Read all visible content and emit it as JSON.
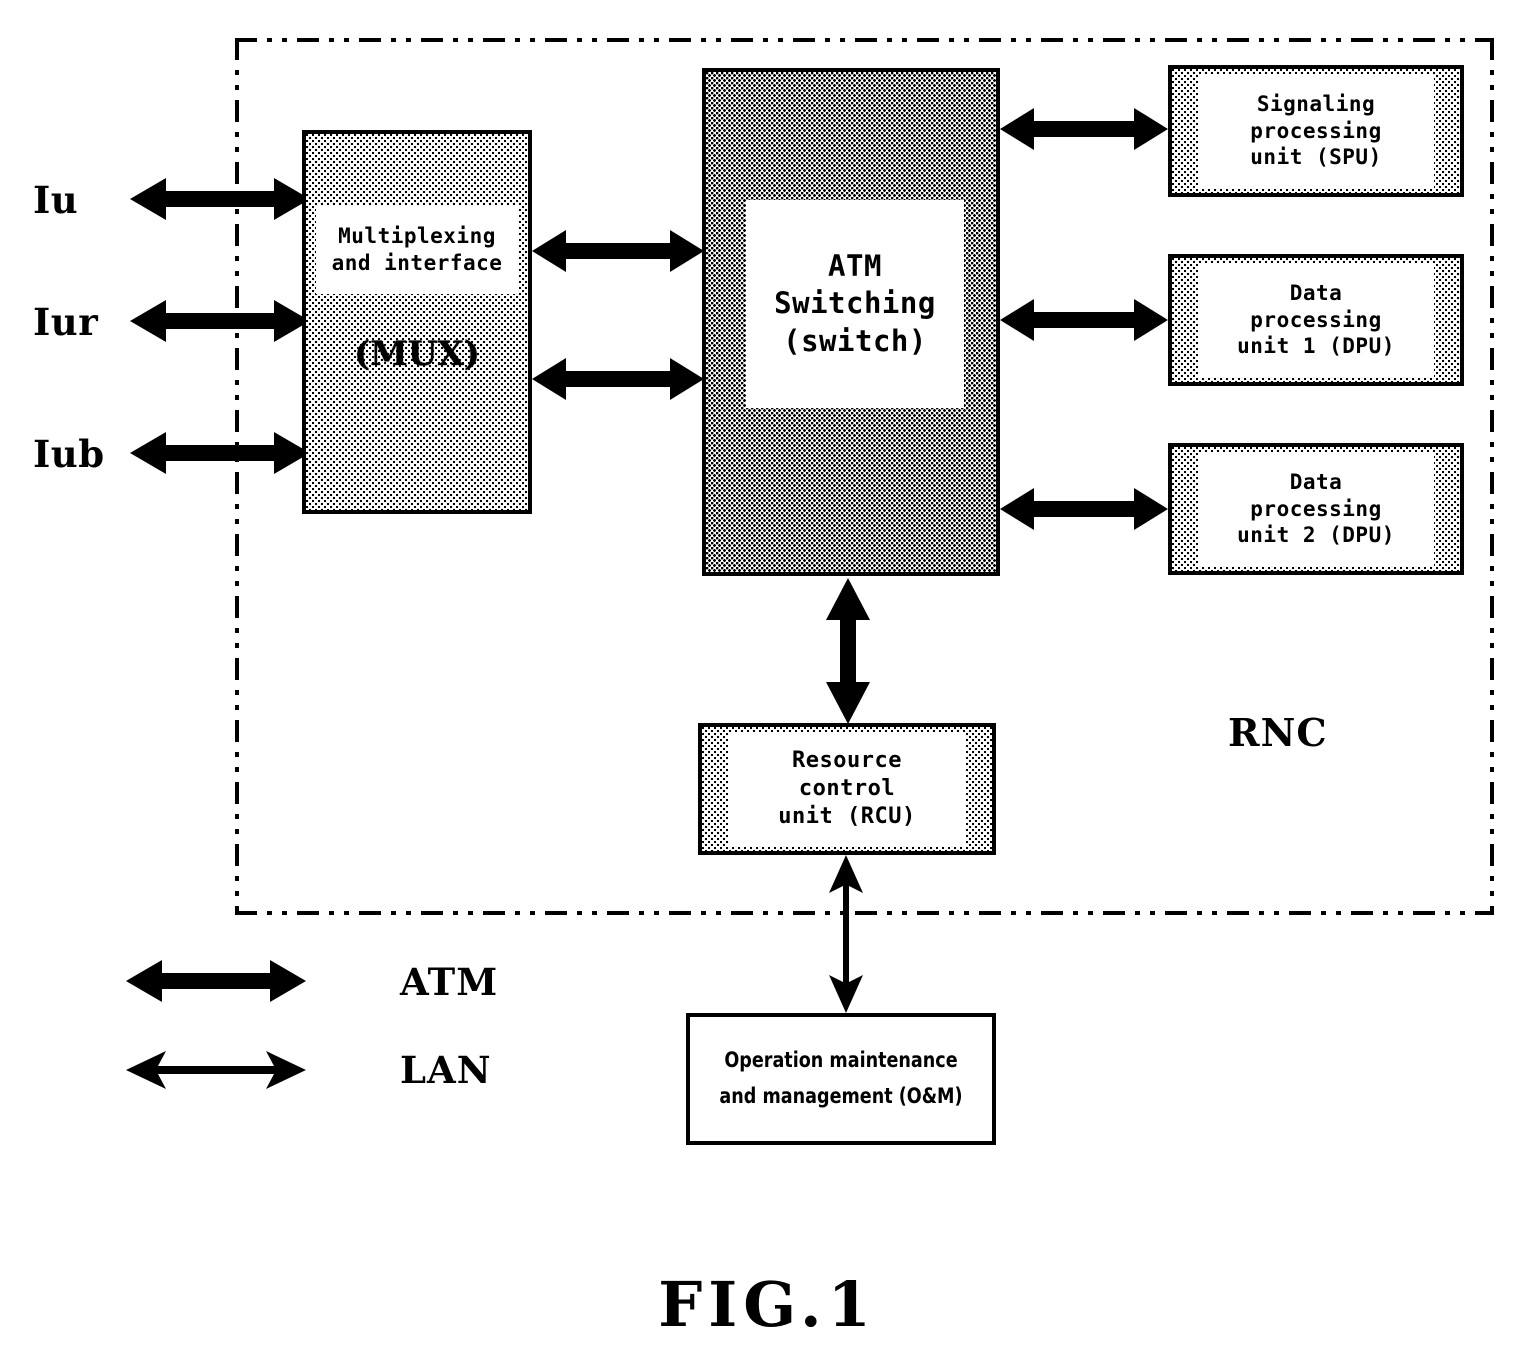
{
  "figure": {
    "caption": "FIG.1",
    "boundary_label": "RNC"
  },
  "interfaces": [
    {
      "name": "Iu",
      "label": "Iu"
    },
    {
      "name": "Iur",
      "label": "Iur"
    },
    {
      "name": "Iub",
      "label": "Iub"
    }
  ],
  "blocks": {
    "mux": {
      "title": "Multiplexing\nand interface",
      "abbr": "(MUX)"
    },
    "atm_switch": {
      "title": "ATM\nSwitching\n(switch)"
    },
    "spu": {
      "title": "Signaling\nprocessing\nunit (SPU)"
    },
    "dpu1": {
      "title": "Data\nprocessing\nunit 1 (DPU)"
    },
    "dpu2": {
      "title": "Data\nprocessing\nunit 2 (DPU)"
    },
    "rcu": {
      "title": "Resource\ncontrol\nunit (RCU)"
    },
    "oam": {
      "title": "Operation maintenance\nand management (O&M)"
    }
  },
  "legend": {
    "atm_label": "ATM",
    "lan_label": "LAN"
  },
  "colors": {
    "ink": "#000000",
    "paper": "#ffffff"
  }
}
